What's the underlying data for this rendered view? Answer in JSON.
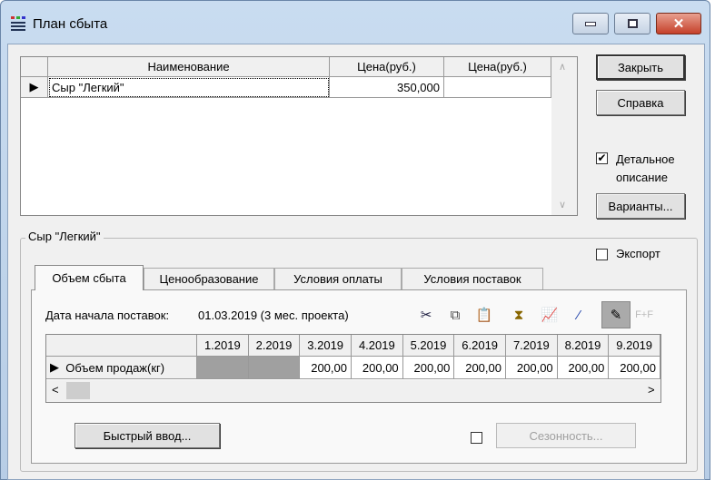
{
  "window": {
    "title": "План сбыта"
  },
  "products_table": {
    "columns": [
      "Наименование",
      "Цена(руб.)",
      "Цена(руб.)"
    ],
    "rows": [
      {
        "name": "Сыр \"Легкий\"",
        "price1": "350,000",
        "price2": ""
      }
    ]
  },
  "buttons": {
    "close": "Закрыть",
    "help": "Справка",
    "variants": "Варианты...",
    "quick_input": "Быстрый ввод...",
    "seasonality": "Сезонность..."
  },
  "detail_checkbox": {
    "label": "Детальное описание",
    "checked": true
  },
  "group": {
    "title": "Сыр \"Легкий\""
  },
  "export_checkbox": {
    "label": "Экспорт",
    "checked": false
  },
  "tabs": [
    "Объем сбыта",
    "Ценообразование",
    "Условия оплаты",
    "Условия поставок"
  ],
  "start_date": {
    "label": "Дата начала поставок:",
    "value": "01.03.2019 (3 мес. проекта)"
  },
  "volume_table": {
    "columns": [
      "1.2019",
      "2.2019",
      "3.2019",
      "4.2019",
      "5.2019",
      "6.2019",
      "7.2019",
      "8.2019",
      "9.2019"
    ],
    "row_label": "Объем продаж(кг)",
    "values": [
      "",
      "",
      "200,00",
      "200,00",
      "200,00",
      "200,00",
      "200,00",
      "200,00",
      "200,00"
    ]
  },
  "seasonality_checkbox": {
    "checked": false
  }
}
